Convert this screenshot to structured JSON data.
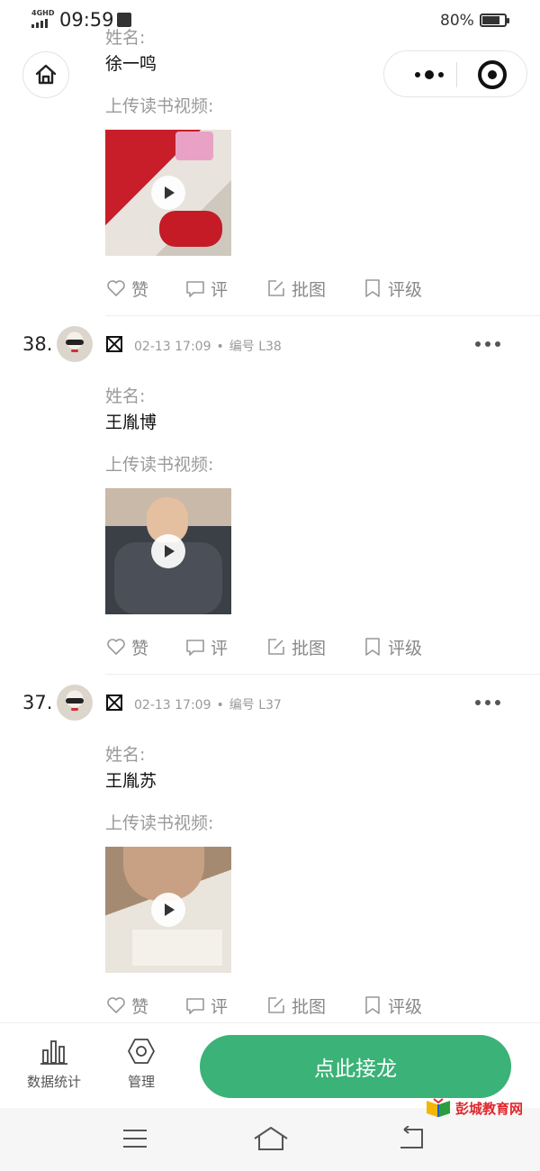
{
  "status_bar": {
    "network": "4GHD",
    "time": "09:59",
    "battery": "80%"
  },
  "icons": {
    "home": "home-icon",
    "more": "more-dots-icon",
    "target": "target-icon",
    "like": "heart-icon",
    "comment": "comment-icon",
    "annotate": "edit-icon",
    "grade": "bookmark-icon",
    "stats": "bar-chart-icon",
    "manage": "hexagon-gear-icon"
  },
  "colors": {
    "accent": "#3bb277",
    "muted_text": "#9a9a9a",
    "watermark": "#e0262a"
  },
  "entries": [
    {
      "name_label": "姓名:",
      "name": "徐一鸣",
      "video_label": "上传读书视频:",
      "actions": {
        "like": "赞",
        "comment": "评",
        "annotate": "批图",
        "grade": "评级"
      }
    },
    {
      "number": "38.",
      "date": "02-13 17:09",
      "dot": "•",
      "code": "编号 L38",
      "name_label": "姓名:",
      "name": "王胤博",
      "video_label": "上传读书视频:",
      "actions": {
        "like": "赞",
        "comment": "评",
        "annotate": "批图",
        "grade": "评级"
      }
    },
    {
      "number": "37.",
      "date": "02-13 17:09",
      "dot": "•",
      "code": "编号 L37",
      "name_label": "姓名:",
      "name": "王胤苏",
      "video_label": "上传读书视频:",
      "actions": {
        "like": "赞",
        "comment": "评",
        "annotate": "批图",
        "grade": "评级"
      }
    }
  ],
  "bottom_bar": {
    "stats_label": "数据统计",
    "manage_label": "管理",
    "relay_button": "点此接龙"
  },
  "watermark": "彭城教育网"
}
